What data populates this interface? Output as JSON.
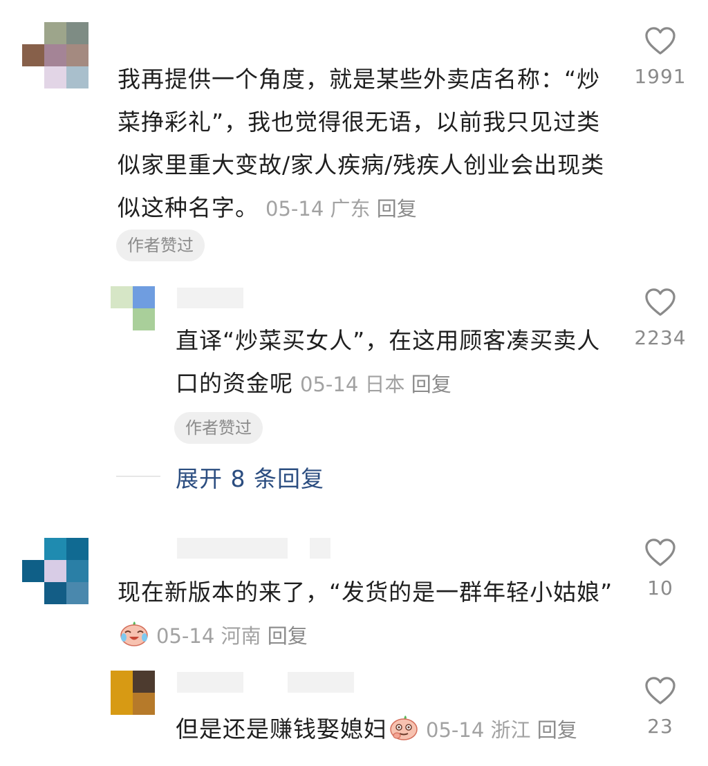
{
  "comments": [
    {
      "text": "我再提供一个角度，就是某些外卖店名称：“炒菜挣彩礼”，我也觉得很无语，以前我只见过类似家里重大变故/家人疾病/残疾人创业会出现类似这种名字。",
      "date": "05-14",
      "location": "广东",
      "reply_label": "回复",
      "badge": "作者赞过",
      "likes": "1991",
      "avatar_icon": "pixelated-avatar",
      "replies": [
        {
          "text": "直译“炒菜买女人”，在这用顾客凑买卖人口的资金呢",
          "date": "05-14",
          "location": "日本",
          "reply_label": "回复",
          "badge": "作者赞过",
          "likes": "2234"
        }
      ],
      "expand_label": "展开 8 条回复"
    },
    {
      "text": "现在新版本的来了，“发货的是一群年轻小姑娘”",
      "emoji": "laugh-cry-emoji",
      "date": "05-14",
      "location": "河南",
      "reply_label": "回复",
      "likes": "10",
      "replies": [
        {
          "text": "但是还是赚钱娶媳妇",
          "emoji": "smirk-emoji",
          "date": "05-14",
          "location": "浙江",
          "reply_label": "回复",
          "likes": "23"
        }
      ]
    }
  ],
  "colors": {
    "link": "#2b4d80",
    "meta": "#a2a2a2",
    "badge_bg": "#efefef"
  }
}
